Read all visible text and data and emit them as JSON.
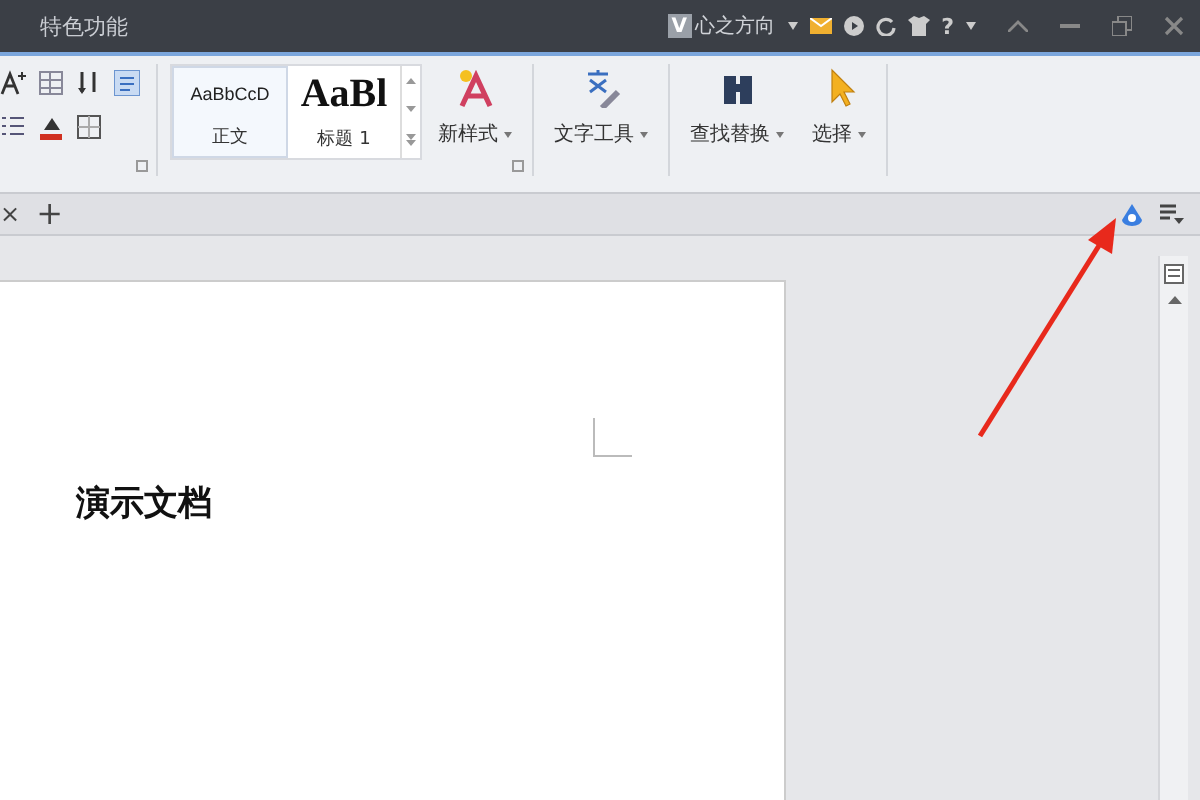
{
  "title_bar": {
    "tab": "特色功能",
    "user": {
      "avatar": "V",
      "name": "心之方向"
    },
    "help": "?"
  },
  "ribbon": {
    "styles": [
      {
        "sample": "AaBbCcD",
        "label": "正文",
        "kind": "body"
      },
      {
        "sample": "AaBl",
        "label": "标题 1",
        "kind": "heading"
      }
    ],
    "buttons": [
      {
        "label": "新样式",
        "kind": "new-style"
      },
      {
        "label": "文字工具",
        "kind": "text-tools"
      },
      {
        "label": "查找替换",
        "kind": "find"
      },
      {
        "label": "选择",
        "kind": "select"
      }
    ]
  },
  "tab_bar": {
    "close": "×",
    "add": "+"
  },
  "document": {
    "heading": "演示文档"
  }
}
